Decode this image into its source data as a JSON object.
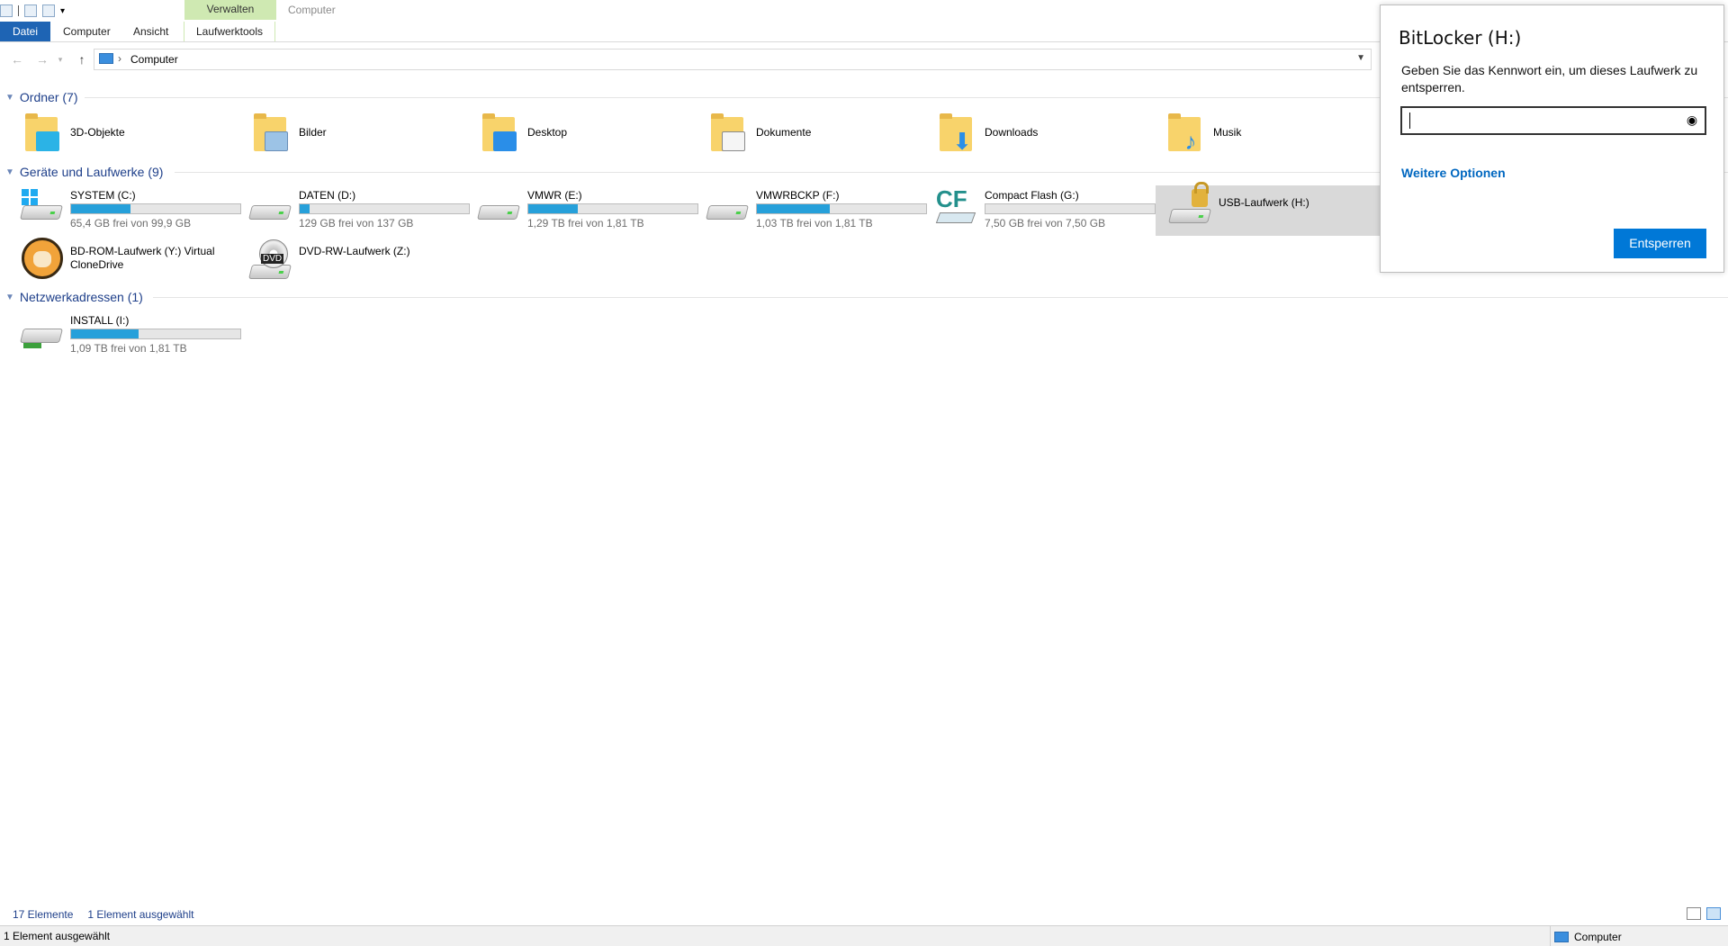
{
  "ribbon": {
    "context_header": "Verwalten",
    "context_title": "Computer",
    "tabs": [
      "Datei",
      "Computer",
      "Ansicht",
      "Laufwerktools"
    ]
  },
  "address": {
    "path": "Computer"
  },
  "groups": {
    "folders": {
      "title": "Ordner (7)",
      "items": [
        "3D-Objekte",
        "Bilder",
        "Desktop",
        "Dokumente",
        "Downloads",
        "Musik"
      ]
    },
    "drives": {
      "title": "Geräte und Laufwerke (9)",
      "items": [
        {
          "name": "SYSTEM (C:)",
          "free": "65,4 GB frei von 99,9 GB",
          "used_fraction": 0.35,
          "icon": "windows-drive-icon"
        },
        {
          "name": "DATEN (D:)",
          "free": "129 GB frei von 137 GB",
          "used_fraction": 0.06,
          "icon": "hard-drive-icon"
        },
        {
          "name": "VMWR (E:)",
          "free": "1,29 TB frei von 1,81 TB",
          "used_fraction": 0.29,
          "icon": "hard-drive-icon"
        },
        {
          "name": "VMWRBCKP (F:)",
          "free": "1,03 TB frei von 1,81 TB",
          "used_fraction": 0.43,
          "icon": "hard-drive-icon"
        },
        {
          "name": "Compact Flash (G:)",
          "free": "7,50 GB frei von 7,50 GB",
          "used_fraction": 0.0,
          "icon": "compact-flash-icon"
        },
        {
          "name": "USB-Laufwerk (H:)",
          "icon": "locked-drive-icon"
        },
        {
          "name": "BD-ROM-Laufwerk (Y:) Virtual CloneDrive",
          "icon": "clonedrive-icon"
        },
        {
          "name": "DVD-RW-Laufwerk (Z:)",
          "icon": "dvd-drive-icon"
        }
      ]
    },
    "network": {
      "title": "Netzwerkadressen (1)",
      "items": [
        {
          "name": "INSTALL (I:)",
          "free": "1,09 TB frei von 1,81 TB",
          "used_fraction": 0.4,
          "icon": "network-drive-icon"
        }
      ]
    }
  },
  "status": {
    "count": "17 Elemente",
    "selected": "1 Element ausgewählt",
    "bottom_left": "1 Element ausgewählt",
    "bottom_right": "Computer"
  },
  "bitlocker": {
    "title": "BitLocker (H:)",
    "message": "Geben Sie das Kennwort ein, um dieses Laufwerk zu entsperren.",
    "more_options": "Weitere Optionen",
    "unlock_button": "Entsperren"
  },
  "colors": {
    "accent": "#0078d7",
    "bar_fill": "#26a0da",
    "group_heading": "#1e3f8a",
    "context_tab": "#cfe9b2"
  }
}
